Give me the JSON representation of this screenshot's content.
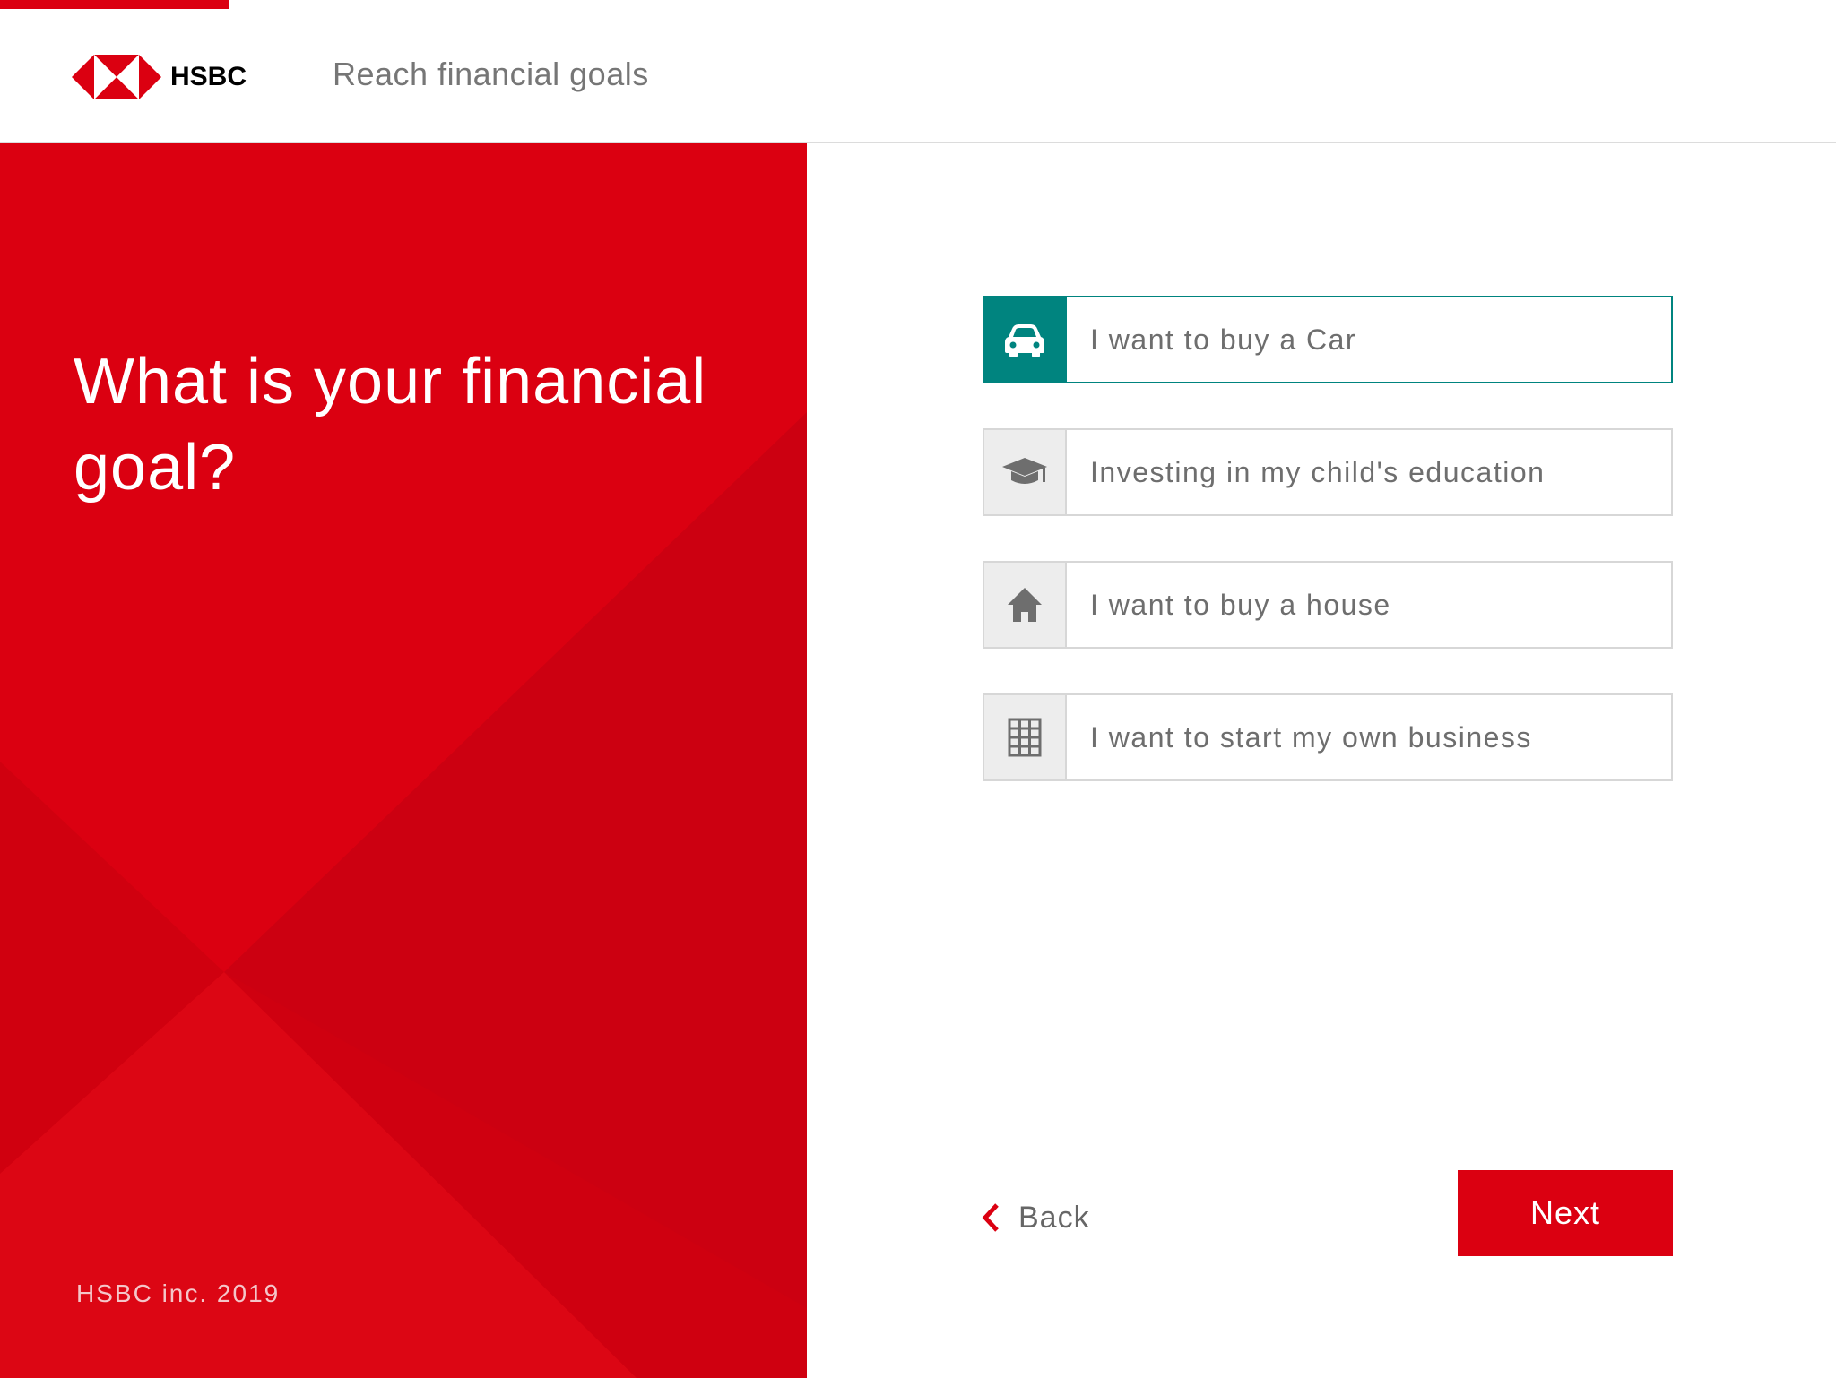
{
  "header": {
    "brand": "HSBC",
    "title": "Reach financial goals"
  },
  "main": {
    "question": "What is your financial goal?",
    "copyright": "HSBC inc. 2019"
  },
  "options": [
    {
      "label": "I want to buy a Car",
      "icon": "car-icon",
      "selected": true
    },
    {
      "label": "Investing in my child's education",
      "icon": "graduation-cap-icon",
      "selected": false
    },
    {
      "label": "I want to buy a house",
      "icon": "house-icon",
      "selected": false
    },
    {
      "label": "I want to start my own business",
      "icon": "building-icon",
      "selected": false
    }
  ],
  "nav": {
    "back_label": "Back",
    "next_label": "Next"
  },
  "colors": {
    "brand_red": "#db0011",
    "selected_teal": "#00847f",
    "text_gray": "#6e6e6e"
  }
}
